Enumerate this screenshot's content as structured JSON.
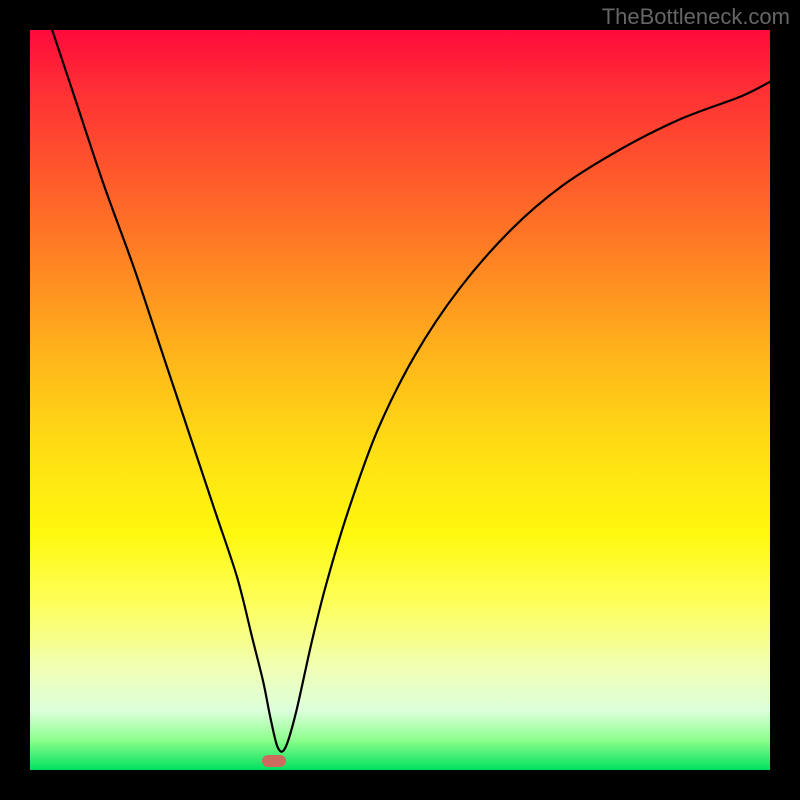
{
  "watermark": "TheBottleneck.com",
  "chart_data": {
    "type": "line",
    "title": "",
    "xlabel": "",
    "ylabel": "",
    "xlim": [
      0,
      100
    ],
    "ylim": [
      0,
      100
    ],
    "grid": false,
    "series": [
      {
        "name": "curve",
        "x": [
          3,
          6,
          10,
          14,
          18,
          22,
          25,
          28,
          30,
          31.5,
          32.5,
          33.5,
          34.5,
          36,
          38,
          40,
          43,
          47,
          52,
          58,
          65,
          72,
          80,
          88,
          96,
          100
        ],
        "y": [
          100,
          91,
          79,
          68,
          56,
          44,
          35,
          26,
          18,
          12,
          7,
          3,
          3,
          8,
          17,
          25,
          35,
          46,
          56,
          65,
          73,
          79,
          84,
          88,
          91,
          93
        ]
      }
    ],
    "marker": {
      "x": 33,
      "y": 1.2
    },
    "background_gradient": {
      "orientation": "vertical",
      "stops": [
        {
          "pct": 0,
          "color": "#ff0a3c"
        },
        {
          "pct": 50,
          "color": "#ffd417"
        },
        {
          "pct": 100,
          "color": "#00e060"
        }
      ]
    }
  },
  "colors": {
    "curve_stroke": "#000000",
    "marker_fill": "#cc6b5e",
    "page_bg": "#000000",
    "watermark": "#666666"
  }
}
